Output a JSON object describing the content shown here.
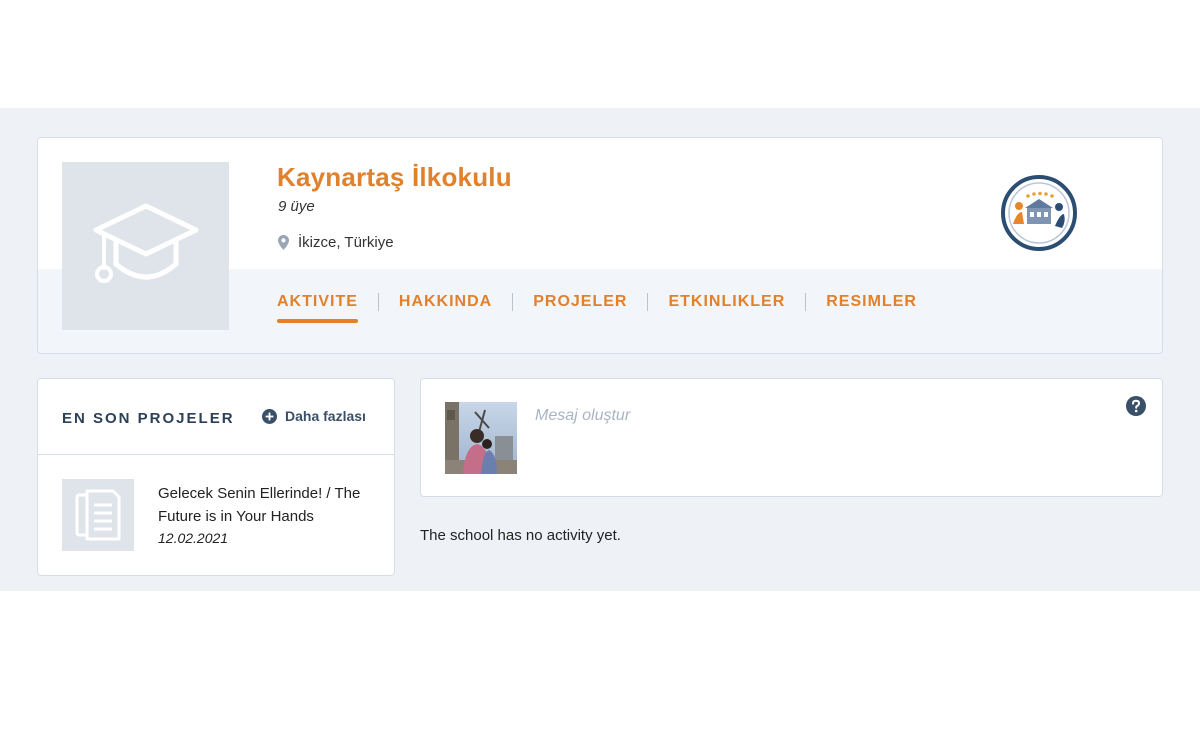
{
  "school": {
    "name": "Kaynartaş İlkokulu",
    "members": "9 üye",
    "location": "İkizce, Türkiye"
  },
  "tabs": [
    {
      "label": "AKTIVITE",
      "active": true
    },
    {
      "label": "HAKKINDA",
      "active": false
    },
    {
      "label": "PROJELER",
      "active": false
    },
    {
      "label": "ETKINLIKLER",
      "active": false
    },
    {
      "label": "RESIMLER",
      "active": false
    }
  ],
  "latest_projects": {
    "title": "EN SON PROJELER",
    "more_label": "Daha fazlası",
    "items": [
      {
        "title": "Gelecek Senin Ellerinde! / The Future is in Your Hands",
        "date": "12.02.2021"
      }
    ]
  },
  "composer": {
    "placeholder": "Mesaj oluştur"
  },
  "activity": {
    "empty_text": "The school has no activity yet."
  },
  "colors": {
    "accent": "#e0812d",
    "navy": "#2c4057",
    "band": "#eef2f7",
    "placeholder_bg": "#dfe4ea"
  },
  "icons": {
    "avatar": "graduation-cap-icon",
    "location": "map-pin-icon",
    "more": "plus-circle-icon",
    "project": "document-icon",
    "help": "question-circle-icon"
  }
}
